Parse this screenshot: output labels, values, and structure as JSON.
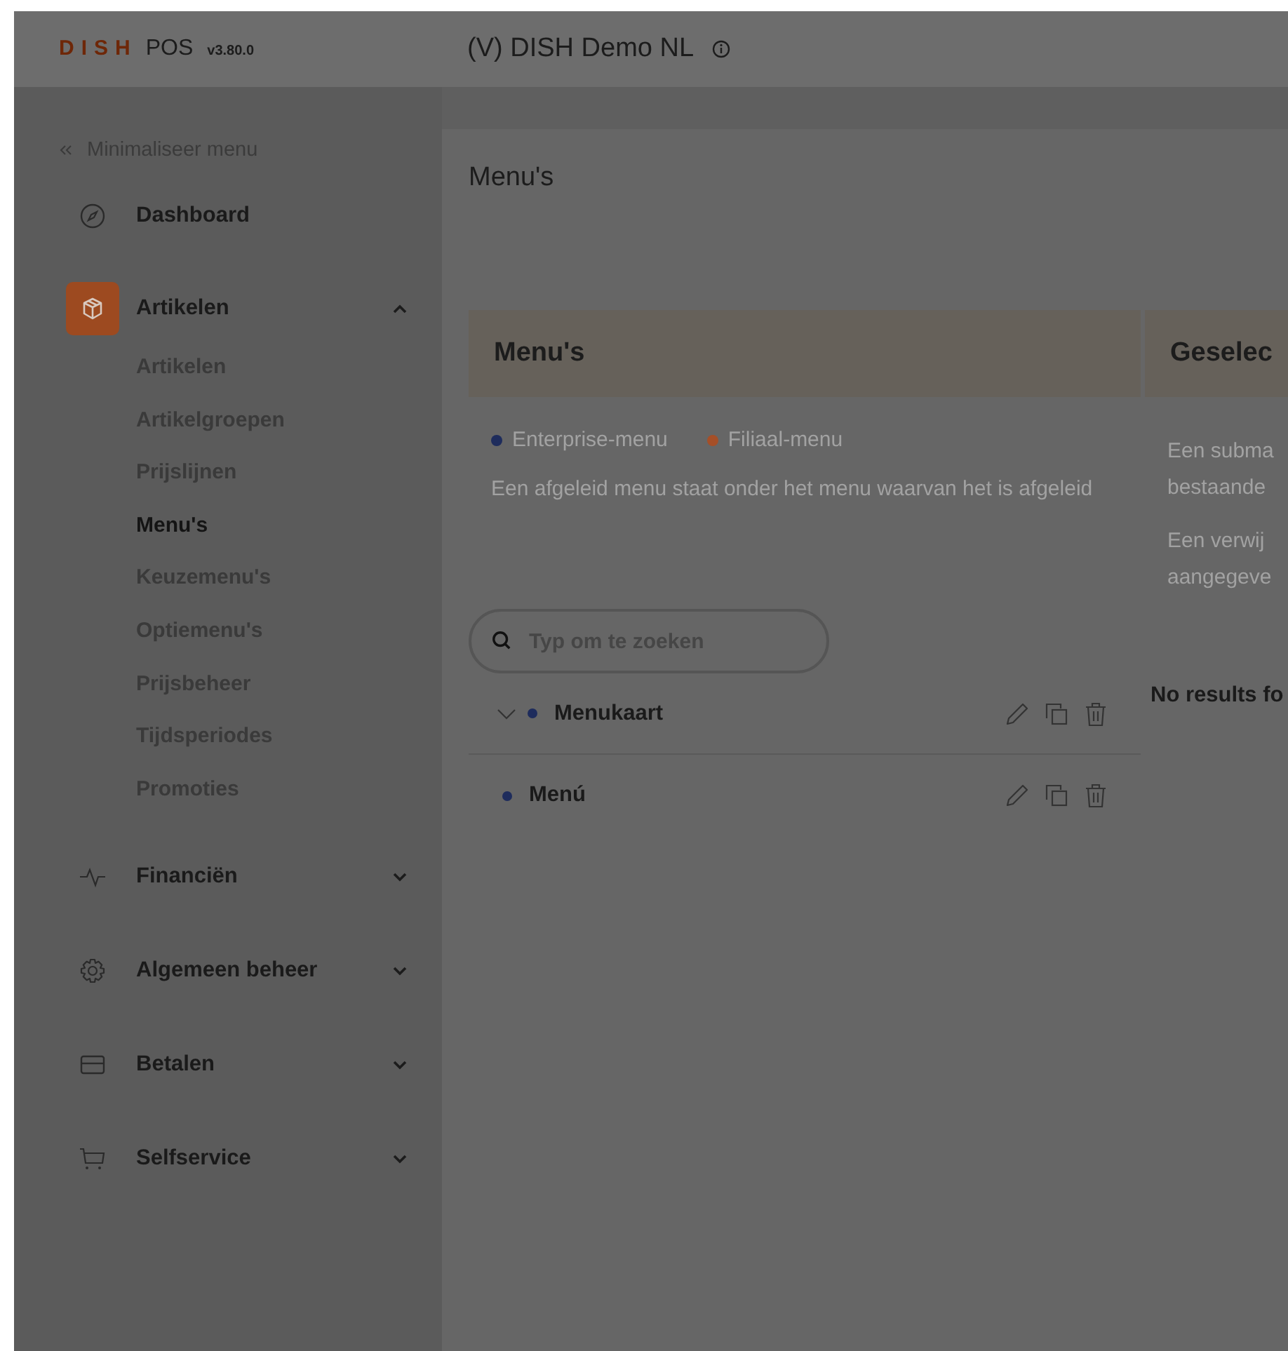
{
  "header": {
    "logo": {
      "brand": "DISH",
      "product": "POS",
      "version": "v3.80.0"
    },
    "title": "(V) DISH Demo NL"
  },
  "sidebar": {
    "collapse_label": "Minimaliseer menu",
    "items": [
      {
        "label": "Dashboard",
        "kind": "link",
        "selected": false
      },
      {
        "label": "Artikelen",
        "kind": "group",
        "selected": true,
        "expanded": true,
        "children": [
          {
            "label": "Artikelen",
            "selected": false
          },
          {
            "label": "Artikelgroepen",
            "selected": false
          },
          {
            "label": "Prijslijnen",
            "selected": false
          },
          {
            "label": "Menu's",
            "selected": true
          },
          {
            "label": "Keuzemenu's",
            "selected": false
          },
          {
            "label": "Optiemenu's",
            "selected": false
          },
          {
            "label": "Prijsbeheer",
            "selected": false
          },
          {
            "label": "Tijdsperiodes",
            "selected": false
          },
          {
            "label": "Promoties",
            "selected": false
          }
        ]
      },
      {
        "label": "Financiën",
        "kind": "group",
        "selected": false,
        "expanded": false
      },
      {
        "label": "Algemeen beheer",
        "kind": "group",
        "selected": false,
        "expanded": false
      },
      {
        "label": "Betalen",
        "kind": "group",
        "selected": false,
        "expanded": false
      },
      {
        "label": "Selfservice",
        "kind": "group",
        "selected": false,
        "expanded": false
      }
    ]
  },
  "page_title": "Menu's",
  "menus_panel": {
    "title": "Menu's",
    "legend": [
      {
        "label": "Enterprise-menu",
        "color": "#1e2c5c"
      },
      {
        "label": "Filiaal-menu",
        "color": "#a54f28"
      }
    ],
    "description": "Een afgeleid menu staat onder het menu waarvan het is afgeleid",
    "search": {
      "placeholder": "Typ om te zoeken"
    },
    "rows": [
      {
        "label": "Menukaart",
        "kind": "parent",
        "expanded": false,
        "color": "#1e2c5c"
      },
      {
        "label": "Menú",
        "kind": "leaf",
        "color": "#1e2c5c"
      }
    ]
  },
  "selected_panel": {
    "title": "Geselec",
    "paragraphs": [
      [
        "Een subma",
        "bestaande"
      ],
      [
        "Een verwij",
        "aangegeve"
      ]
    ],
    "empty_text": "No results fo"
  }
}
